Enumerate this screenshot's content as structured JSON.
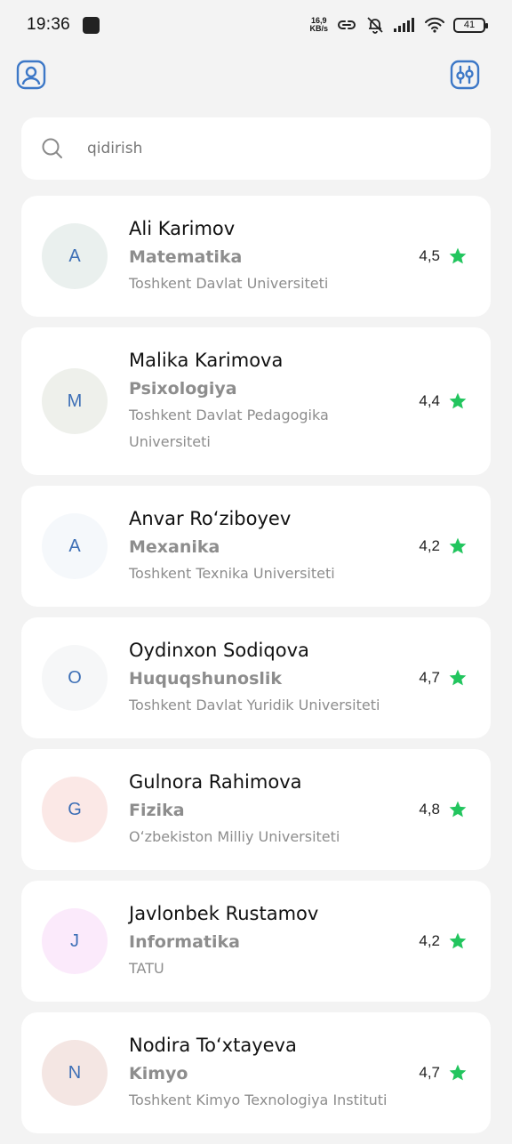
{
  "status_bar": {
    "time": "19:36",
    "net_speed_top": "16,9",
    "net_speed_bottom": "KB/s",
    "battery": "41"
  },
  "header": {
    "profile_icon": "user-icon",
    "filter_icon": "filter-sliders-icon"
  },
  "search": {
    "placeholder": "qidirish",
    "icon": "search-icon"
  },
  "colors": {
    "accent": "#3d78c7",
    "star": "#22c55e",
    "background": "#f3f3f3"
  },
  "teachers": [
    {
      "initial": "A",
      "name": "Ali Karimov",
      "subject": "Matematika",
      "university": "Toshkent Davlat Universiteti",
      "rating": "4,5",
      "avatar_bg": "#eaf0ee"
    },
    {
      "initial": "M",
      "name": "Malika Karimova",
      "subject": "Psixologiya",
      "university": "Toshkent Davlat Pedagogika Universiteti",
      "rating": "4,4",
      "avatar_bg": "#eef0eb"
    },
    {
      "initial": "A",
      "name": "Anvar Roʻziboyev",
      "subject": "Mexanika",
      "university": "Toshkent Texnika Universiteti",
      "rating": "4,2",
      "avatar_bg": "#f5f8fb"
    },
    {
      "initial": "O",
      "name": "Oydinxon Sodiqova",
      "subject": "Huquqshunoslik",
      "university": "Toshkent Davlat Yuridik Universiteti",
      "rating": "4,7",
      "avatar_bg": "#f6f7f8"
    },
    {
      "initial": "G",
      "name": "Gulnora Rahimova",
      "subject": "Fizika",
      "university": "Oʻzbekiston Milliy Universiteti",
      "rating": "4,8",
      "avatar_bg": "#fbe8e6"
    },
    {
      "initial": "J",
      "name": "Javlonbek Rustamov",
      "subject": "Informatika",
      "university": "TATU",
      "rating": "4,2",
      "avatar_bg": "#fbeafb"
    },
    {
      "initial": "N",
      "name": "Nodira Toʻxtayeva",
      "subject": "Kimyo",
      "university": "Toshkent Kimyo Texnologiya Instituti",
      "rating": "4,7",
      "avatar_bg": "#f4e6e3"
    }
  ]
}
